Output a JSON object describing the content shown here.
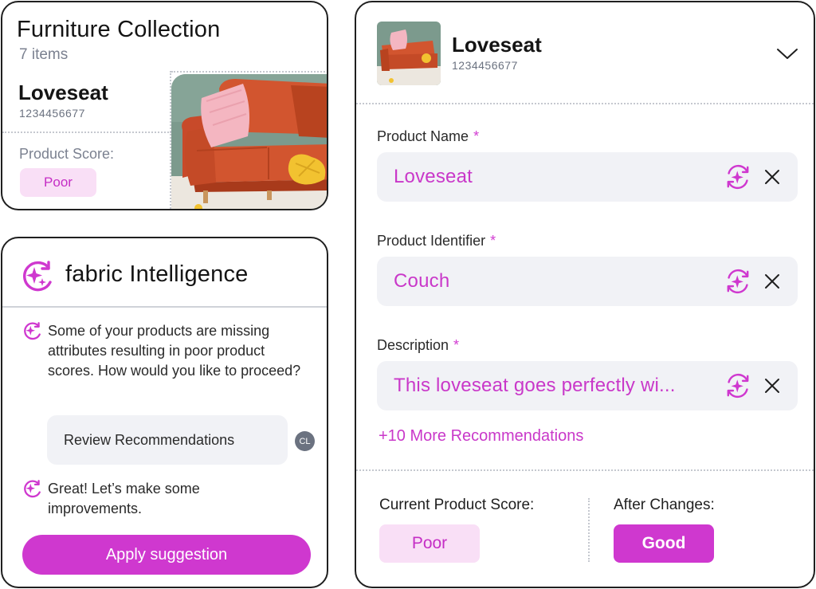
{
  "collection": {
    "title": "Furniture Collection",
    "count": "7 items",
    "product_name": "Loveseat",
    "product_sku": "1234456677",
    "score_label": "Product Score:",
    "score_value": "Poor"
  },
  "assistant": {
    "title": "fabric Intelligence",
    "messages": [
      "Some of your products are missing attributes resulting in poor product scores. How would you like to proceed?",
      "Great! Let’s make some improvements."
    ],
    "user_reply": "Review Recommendations",
    "user_initials": "CL",
    "apply_button": "Apply suggestion"
  },
  "detail": {
    "product_name": "Loveseat",
    "product_sku": "1234456677",
    "required_mark": "*",
    "fields": [
      {
        "label": "Product Name",
        "value": "Loveseat"
      },
      {
        "label": "Product Identifier",
        "value": "Couch"
      },
      {
        "label": "Description",
        "value": "This loveseat goes perfectly wi..."
      }
    ],
    "more_link": "+10 More Recommendations",
    "current_score_label": "Current Product Score:",
    "current_score_value": "Poor",
    "after_label": "After Changes:",
    "after_value": "Good"
  },
  "colors": {
    "accent": "#cf38cf",
    "accent_light": "#f9dff6",
    "field_bg": "#f1f2f6"
  },
  "icons": [
    "sparkle-refresh-icon",
    "close-icon",
    "chevron-down-icon",
    "fabric-ai-icon"
  ]
}
